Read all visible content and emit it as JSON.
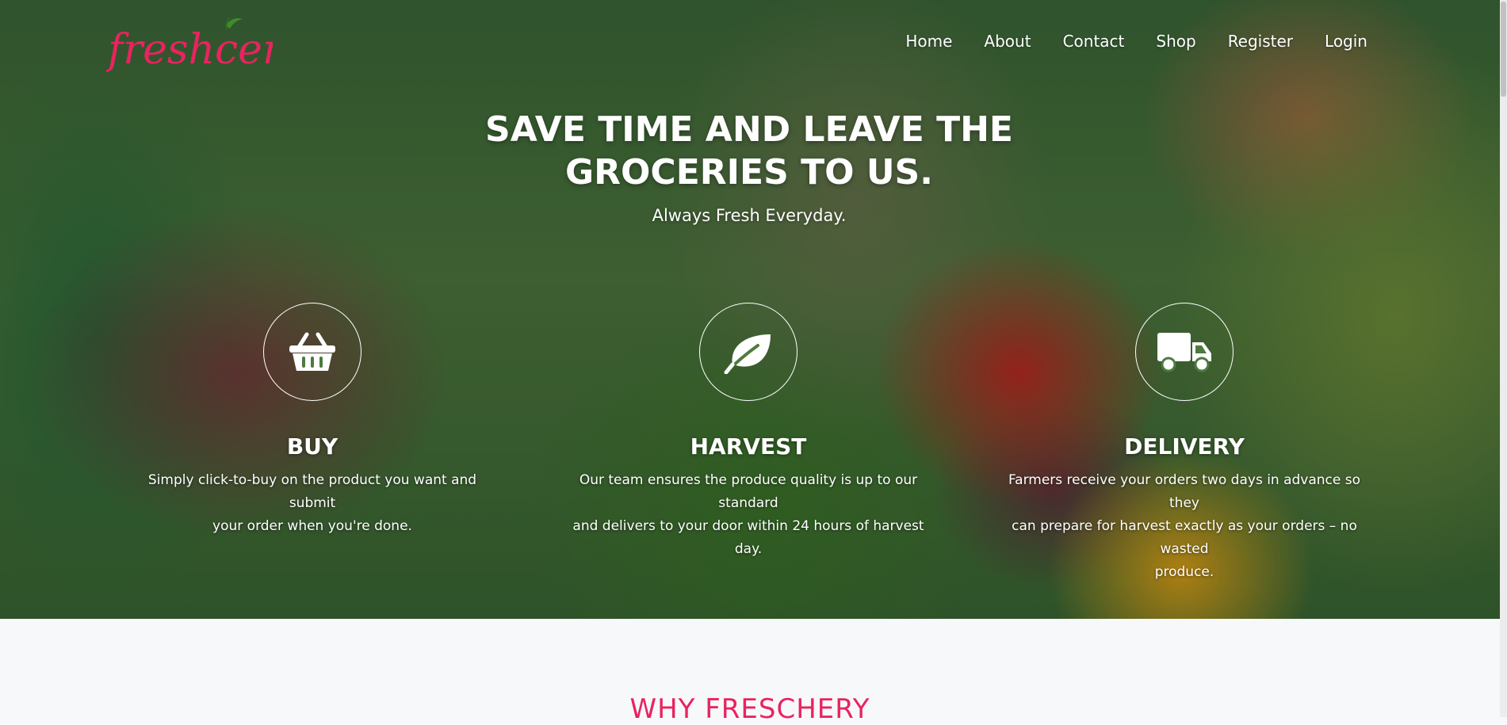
{
  "brand": {
    "logo_text": "freshcery",
    "accent_color": "#e8245f"
  },
  "nav": {
    "items": [
      {
        "label": "Home"
      },
      {
        "label": "About"
      },
      {
        "label": "Contact"
      },
      {
        "label": "Shop"
      },
      {
        "label": "Register"
      },
      {
        "label": "Login"
      }
    ]
  },
  "hero": {
    "headline_line1": "SAVE TIME AND LEAVE THE",
    "headline_line2": "GROCERIES TO US.",
    "subheadline": "Always Fresh Everyday."
  },
  "features": [
    {
      "icon": "shopping-basket-icon",
      "title": "BUY",
      "line1": "Simply click-to-buy on the product you want and submit",
      "line2": "your order when you're done."
    },
    {
      "icon": "leaf-icon",
      "title": "HARVEST",
      "line1": "Our team ensures the produce quality is up to our standard",
      "line2": "and delivers to your door within 24 hours of harvest day."
    },
    {
      "icon": "delivery-truck-icon",
      "title": "DELIVERY",
      "line1": "Farmers receive your orders two days in advance so they",
      "line2": "can prepare for harvest exactly as your orders – no wasted",
      "line3": "produce."
    }
  ],
  "why_section": {
    "title": "WHY FRESCHERY"
  }
}
